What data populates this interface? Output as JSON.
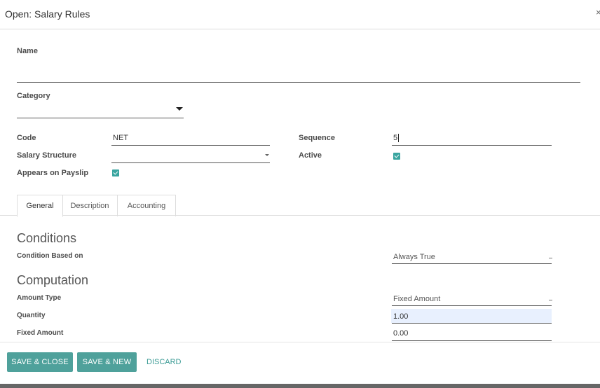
{
  "dialog": {
    "title": "Open: Salary Rules",
    "close_glyph": "×"
  },
  "form": {
    "name_label": "Name",
    "name_value": "",
    "category_label": "Category",
    "category_value": "",
    "code_label": "Code",
    "code_value": "NET",
    "salary_structure_label": "Salary Structure",
    "salary_structure_value": "",
    "appears_on_payslip_label": "Appears on Payslip",
    "appears_on_payslip_checked": true,
    "sequence_label": "Sequence",
    "sequence_value": "5",
    "active_label": "Active",
    "active_checked": true
  },
  "tabs": [
    {
      "label": "General",
      "active": true
    },
    {
      "label": "Description",
      "active": false
    },
    {
      "label": "Accounting",
      "active": false
    }
  ],
  "general": {
    "conditions_heading": "Conditions",
    "condition_based_on_label": "Condition Based on",
    "condition_based_on_value": "Always True",
    "computation_heading": "Computation",
    "amount_type_label": "Amount Type",
    "amount_type_value": "Fixed Amount",
    "quantity_label": "Quantity",
    "quantity_value": "1.00",
    "fixed_amount_label": "Fixed Amount",
    "fixed_amount_value": "0.00"
  },
  "footer": {
    "save_close_label": "SAVE & CLOSE",
    "save_new_label": "SAVE & NEW",
    "discard_label": "DISCARD"
  },
  "colors": {
    "accent": "#4fa19b",
    "checkbox": "#3aa5a0",
    "highlight_field": "#e8f0fe",
    "bottom_bar": "#666666"
  }
}
